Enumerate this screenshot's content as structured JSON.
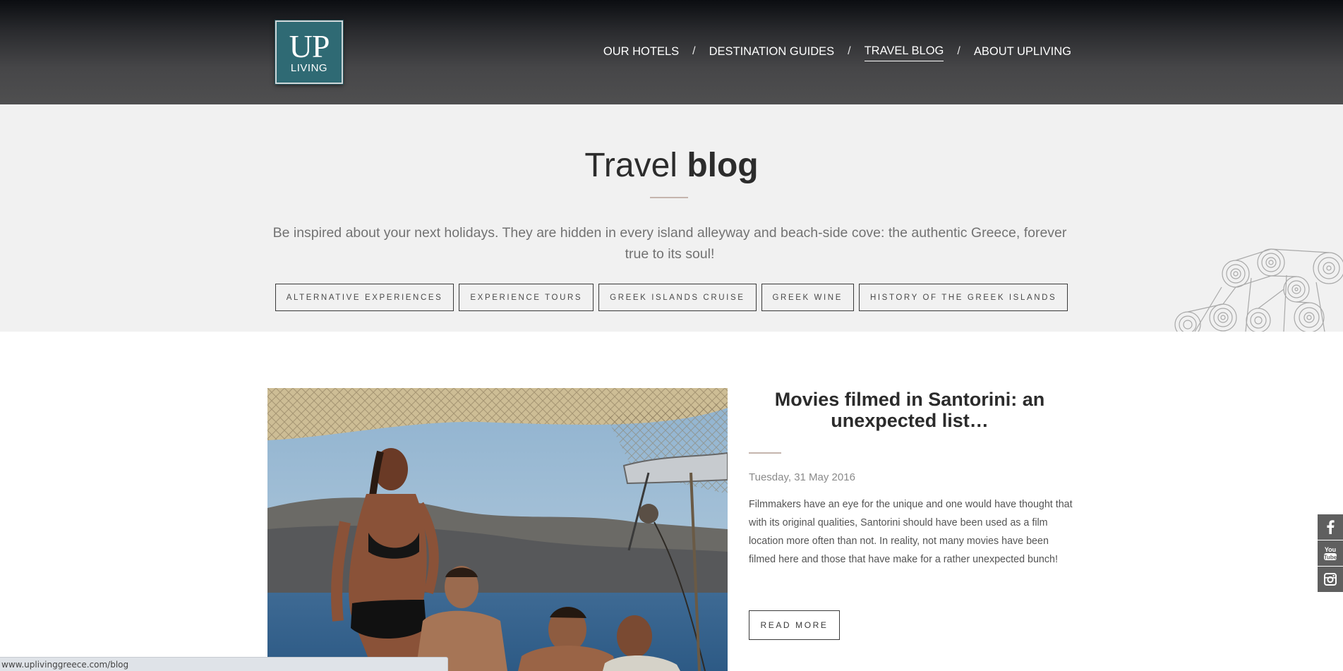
{
  "logo": {
    "line1": "UP",
    "line2": "LIVING"
  },
  "nav": {
    "items": [
      {
        "label": "OUR HOTELS",
        "active": false
      },
      {
        "label": "DESTINATION GUIDES",
        "active": false
      },
      {
        "label": "TRAVEL BLOG",
        "active": true
      },
      {
        "label": "ABOUT UPLIVING",
        "active": false
      }
    ],
    "separator": "/"
  },
  "hero": {
    "title_light": "Travel",
    "title_bold": "blog",
    "description": "Be inspired about your next holidays. They are hidden in every island alleyway and beach-side cove: the authentic Greece, forever true to its soul!",
    "categories": [
      "ALTERNATIVE EXPERIENCES",
      "EXPERIENCE TOURS",
      "GREEK ISLANDS CRUISE",
      "GREEK WINE",
      "HISTORY OF THE GREEK ISLANDS"
    ]
  },
  "post": {
    "title": "Movies filmed in Santorini: an unexpected list…",
    "date": "Tuesday, 31 May 2016",
    "excerpt": "Filmmakers have an eye for the unique and one would have thought that with its original qualities, Santorini should have been used as a film location more often than not. In reality, not many movies have been filmed here and those that have make for a rather unexpected bunch!",
    "read_more": "READ MORE"
  },
  "social": {
    "icons": [
      "facebook-icon",
      "youtube-icon",
      "instagram-icon"
    ],
    "youtube_label": "You Tube"
  },
  "statusbar": {
    "url": "www.uplivinggreece.com/blog"
  },
  "colors": {
    "header_dark": "#0b0d11",
    "header_mid": "#4f4f50",
    "logo_bg": "#2f6a74",
    "hero_bg": "#f1f1f1",
    "accent_divider": "#c5b5ad",
    "social_bg": "#5f5f5f"
  }
}
